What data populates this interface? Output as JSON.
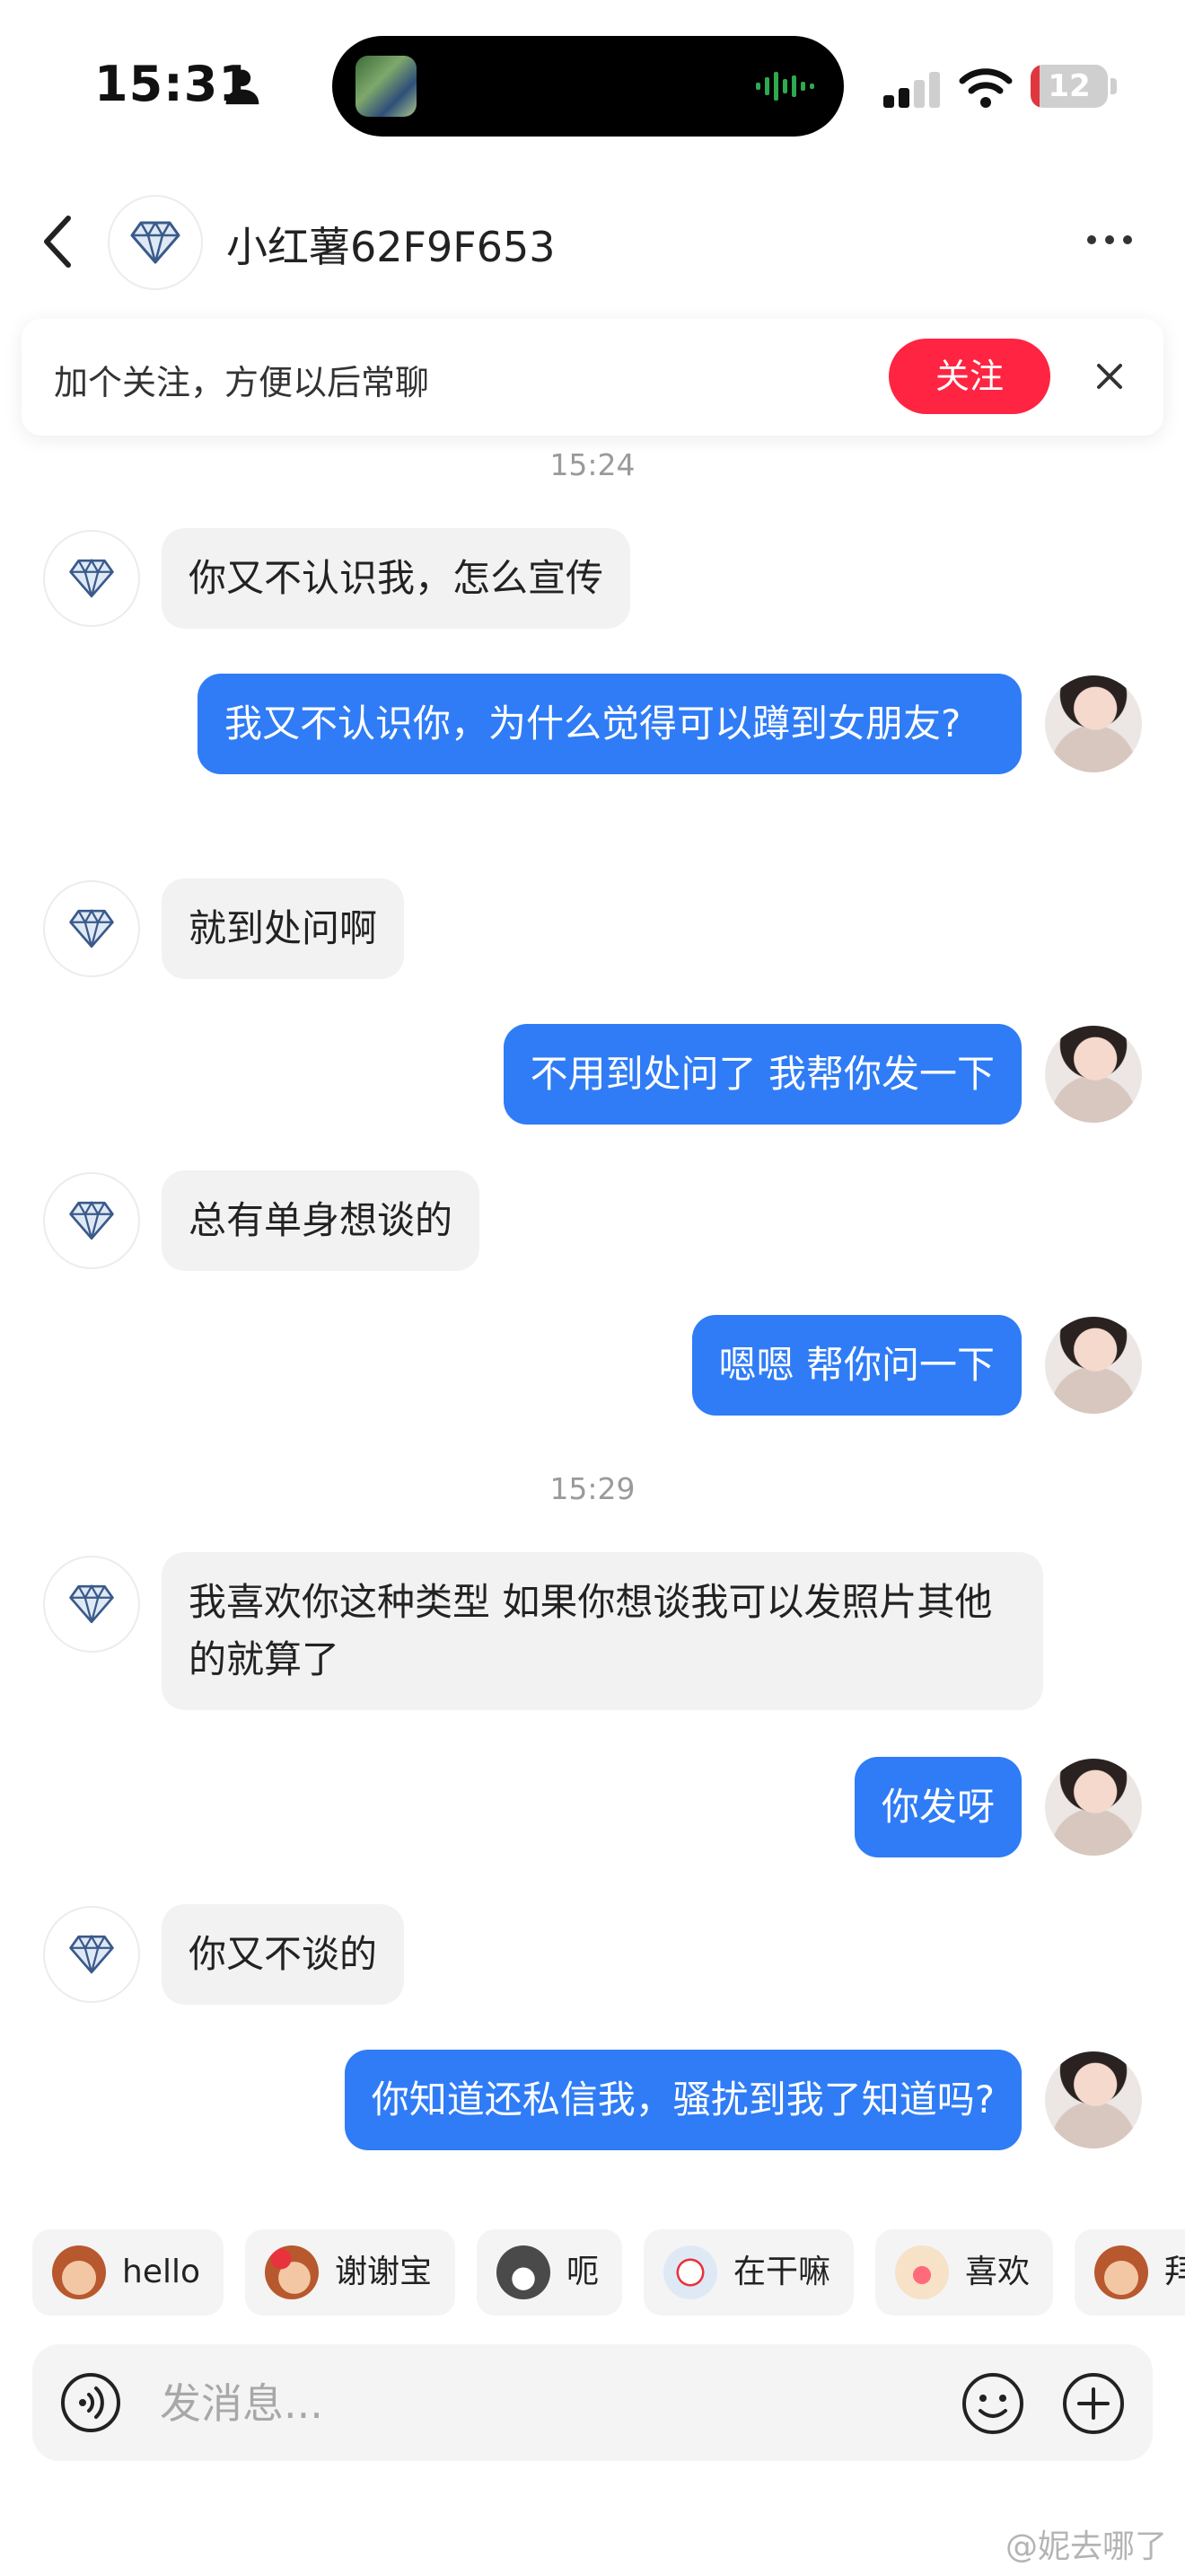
{
  "status_bar": {
    "time": "15:31",
    "battery": "12",
    "battery_level": 0.12
  },
  "header": {
    "title": "小红薯62F9F653"
  },
  "banner": {
    "text": "加个关注，方便以后常聊",
    "follow_label": "关注"
  },
  "messages": {
    "ts1": "15:24",
    "m1": "你又不认识我，怎么宣传",
    "m2": "我又不认识你，为什么觉得可以蹲到女朋友?",
    "m3": "就到处问啊",
    "m4": "不用到处问了 我帮你发一下",
    "m5": "总有单身想谈的",
    "m6": "嗯嗯 帮你问一下",
    "ts2": "15:29",
    "m7": "我喜欢你这种类型 如果你想谈我可以发照片其他的就算了",
    "m8": "你发呀",
    "m9": "你又不谈的",
    "m10": "你知道还私信我，骚扰到我了知道吗?"
  },
  "quick_replies": [
    "hello",
    "谢谢宝",
    "呃",
    "在干嘛",
    "喜欢",
    "拜"
  ],
  "input": {
    "placeholder": "发消息..."
  },
  "watermark": "@妮去哪了",
  "colors": {
    "accent": "#ff2442",
    "my_bubble": "#2f7cf6",
    "other_bubble": "#f2f2f2"
  }
}
